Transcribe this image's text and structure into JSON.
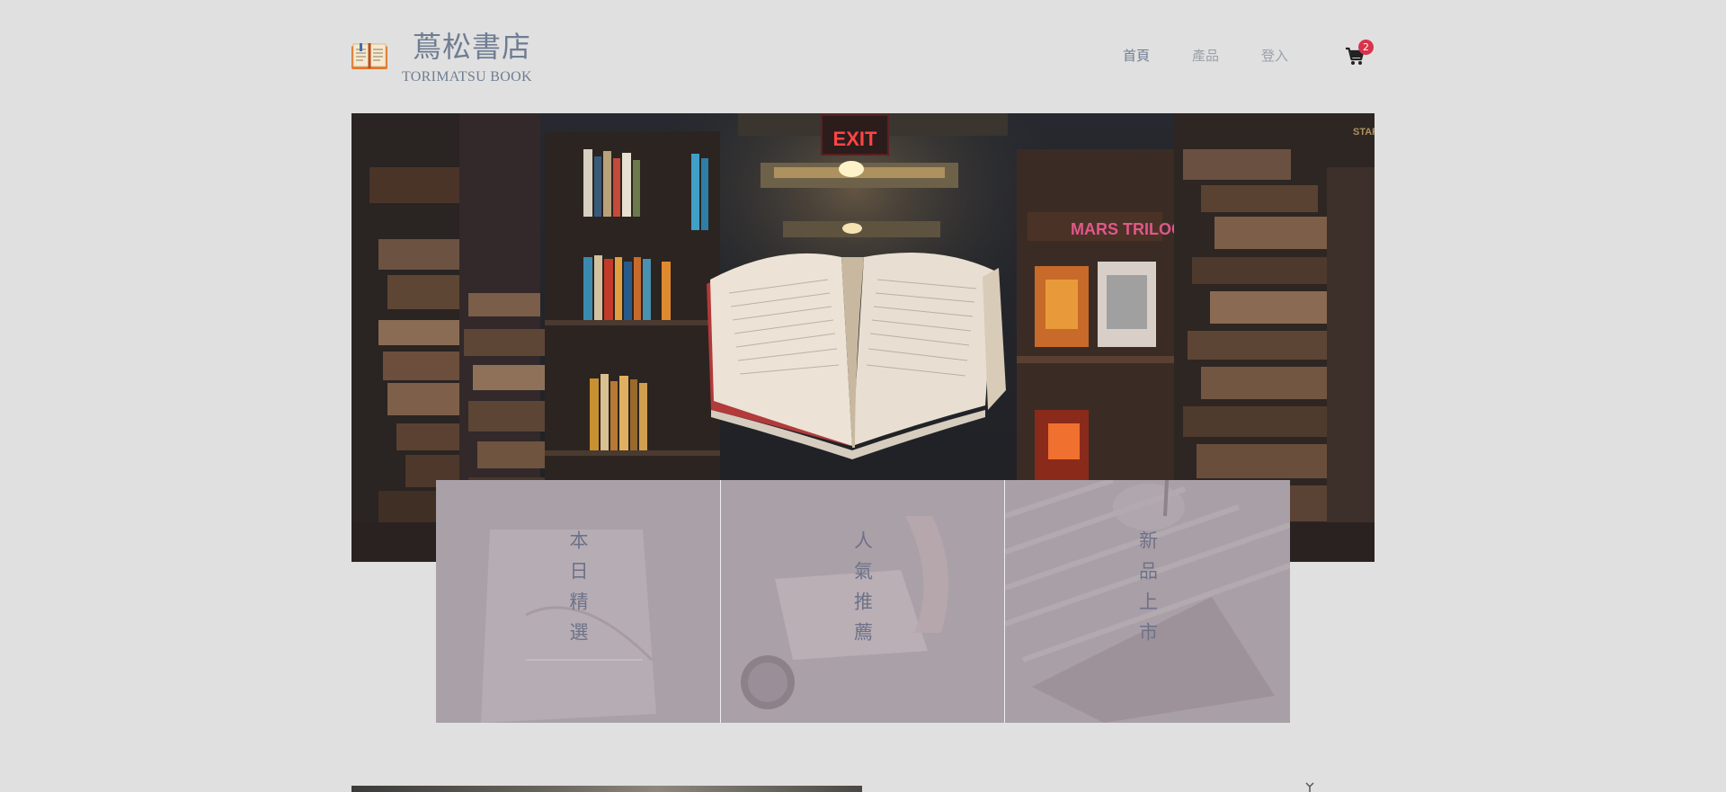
{
  "header": {
    "brand_title": "蔦松書店",
    "brand_subtitle": "TORIMATSU BOOK",
    "logo_icon": "open-book-icon"
  },
  "nav": {
    "items": [
      {
        "label": "首頁",
        "active": true
      },
      {
        "label": "產品",
        "active": false
      },
      {
        "label": "登入",
        "active": false
      }
    ],
    "cart_icon": "shopping-cart-icon",
    "cart_count": "2"
  },
  "hero": {
    "exit_sign": "EXIT",
    "shelf_sign": "MARS TRILOGY",
    "corner_text": "STAR"
  },
  "categories": [
    {
      "label": "本日精選"
    },
    {
      "label": "人氣推薦"
    },
    {
      "label": "新品上市"
    }
  ],
  "colors": {
    "background": "#e0e0e0",
    "brand_text": "#6f7d92",
    "card_overlay": "#a89ea6",
    "badge": "#d8344a"
  }
}
